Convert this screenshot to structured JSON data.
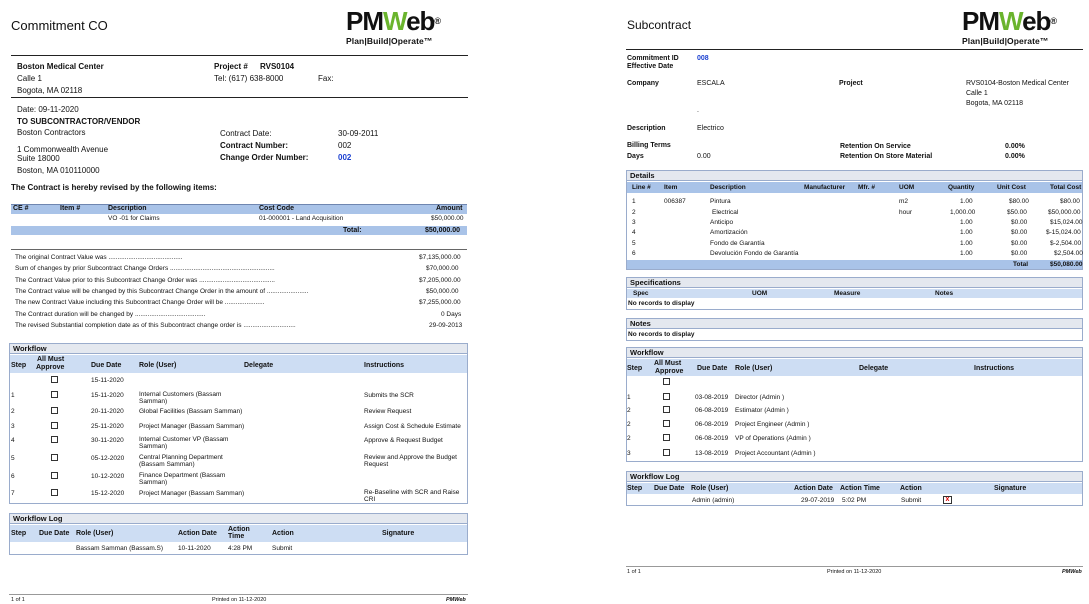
{
  "logo": {
    "brand_pm": "PM",
    "brand_w": "W",
    "brand_eb": "eb",
    "registered": "®",
    "tagline": "Plan|Build|Operate™"
  },
  "left": {
    "title": "Commitment CO",
    "client": {
      "name": "Boston Medical Center",
      "address1": "Calle 1",
      "city": "Bogota, MA 02118"
    },
    "project": {
      "label": "Project #",
      "value": "RVS0104",
      "tel": "Tel: (617) 638-8000",
      "fax": "Fax:"
    },
    "date": "Date: 09-11-2020",
    "to_label": "TO SUBCONTRACTOR/VENDOR",
    "vendor": {
      "name": "Boston Contractors",
      "address1": "1 Commonwealth Avenue",
      "address2": "Suite 18000",
      "city": "Boston, MA 010110000"
    },
    "contract": {
      "date_label": "Contract Date:",
      "date_value": "30-09-2011",
      "number_label": "Contract Number:",
      "number_value": "002",
      "co_label": "Change Order Number:",
      "co_value": "002"
    },
    "revised_text": "The Contract is hereby revised by the following items:",
    "items": {
      "headers": [
        "CE #",
        "Item #",
        "Description",
        "Cost Code",
        "Amount"
      ],
      "rows": [
        {
          "ce": "",
          "item": "",
          "description": "VO -01 for Claims",
          "cost_code": "01-000001 - Land Acquisition",
          "amount": "$50,000.00"
        }
      ],
      "total_label": "Total:",
      "total_value": "$50,000.00"
    },
    "summary": [
      {
        "label": "The original Contract Value was .........................................",
        "value": "$7,135,000.00"
      },
      {
        "label": "Sum of changes by prior Subcontract Change Orders ..........................................................",
        "value": "$70,000.00"
      },
      {
        "label": "The Contract Value prior to this Subcontract Change Order was ..........................................",
        "value": "$7,205,000.00"
      },
      {
        "label": "The Contract value will be changed by this Subcontract Change Order in the amount of .......................",
        "value": "$50,000.00"
      },
      {
        "label": "The new Contract Value including this Subcontract Change Order will be ......................",
        "value": "$7,255,000.00"
      },
      {
        "label": "The Contract duration will be changed by .......................................",
        "value": "0 Days"
      },
      {
        "label": "The revised Substantial completion date as  of this Subcontract change order is .............................",
        "value": "29-09-2013"
      }
    ],
    "workflow": {
      "title": "Workflow",
      "headers": {
        "step": "Step",
        "all_must": "All Must",
        "approve": "Approve",
        "due": "Due Date",
        "role": "Role (User)",
        "delegate": "Delegate",
        "instructions": "Instructions"
      },
      "rows": [
        {
          "step": "",
          "due": "15-11-2020",
          "role": "",
          "role2": "",
          "instr": "",
          "instr2": ""
        },
        {
          "step": "1",
          "due": "15-11-2020",
          "role": "Internal Customers (Bassam",
          "role2": "Samman)",
          "instr": "Submits the SCR",
          "instr2": ""
        },
        {
          "step": "2",
          "due": "20-11-2020",
          "role": "Global Facilities (Bassam Samman)",
          "role2": "",
          "instr": "Review Request",
          "instr2": ""
        },
        {
          "step": "3",
          "due": "25-11-2020",
          "role": "Project Manager (Bassam Samman)",
          "role2": "",
          "instr": "Assign Cost & Schedule Estimate",
          "instr2": ""
        },
        {
          "step": "4",
          "due": "30-11-2020",
          "role": "Internal Customer VP (Bassam",
          "role2": "Samman)",
          "instr": "Approve & Request Budget",
          "instr2": ""
        },
        {
          "step": "5",
          "due": "05-12-2020",
          "role": "Central Planning Department",
          "role2": "(Bassam Samman)",
          "instr": "Review and Approve the Budget",
          "instr2": "Request"
        },
        {
          "step": "6",
          "due": "10-12-2020",
          "role": "Finance Department (Bassam",
          "role2": "Samman)",
          "instr": "",
          "instr2": ""
        },
        {
          "step": "7",
          "due": "15-12-2020",
          "role": "Project Manager (Bassam Samman)",
          "role2": "",
          "instr": "Re-Baseline with SCR and Raise",
          "instr2": "CRI"
        }
      ]
    },
    "log": {
      "title": "Workflow Log",
      "headers": {
        "step": "Step",
        "due": "Due Date",
        "role": "Role (User)",
        "action_date": "Action Date",
        "action_time1": "Action",
        "action_time2": "Time",
        "action": "Action",
        "signature": "Signature"
      },
      "row": {
        "role": "Bassam Samman (Bassam.S)",
        "action_date": "10-11-2020",
        "action_time": "4:28 PM",
        "action": "Submit"
      }
    },
    "footer": {
      "page": "1 of 1",
      "printed": "Printed on 11-12-2020",
      "brand": "PMWeb"
    }
  },
  "right": {
    "title": "Subcontract",
    "commitment_id_label": "Commitment ID",
    "commitment_id_value": "008",
    "effective_date_label": "Effective Date",
    "company_label": "Company",
    "company_value": "ESCALA",
    "project_label": "Project",
    "project_value": "RVS0104-Boston Medical Center",
    "project_addr1": "Calle 1",
    "project_city": "Bogota, MA 02118",
    "dot": ".",
    "description_label": "Description",
    "description_value": "Electrico",
    "billing_terms_label": "Billing Terms",
    "days_label": "Days",
    "days_value": "0.00",
    "retention_service_label": "Retention On Service",
    "retention_service_value": "0.00%",
    "retention_store_label": "Retention On Store Material",
    "retention_store_value": "0.00%",
    "details": {
      "title": "Details",
      "headers": [
        "Line #",
        "Item",
        "Description",
        "Manufacturer",
        "Mfr. #",
        "UOM",
        "Quantity",
        "Unit Cost",
        "Total Cost"
      ],
      "rows": [
        {
          "line": "1",
          "item": "006387",
          "desc": "Pintura",
          "uom": "m2",
          "qty": "1.00",
          "unit": "$80.00",
          "total": "$80.00"
        },
        {
          "line": "2",
          "item": "",
          "desc": "Electrical",
          "uom": "hour",
          "qty": "1,000.00",
          "unit": "$50.00",
          "total": "$50,000.00"
        },
        {
          "line": "3",
          "item": "",
          "desc": "Anticipo",
          "uom": "",
          "qty": "1.00",
          "unit": "$0.00",
          "total": "$15,024.00"
        },
        {
          "line": "4",
          "item": "",
          "desc": "Amortización",
          "uom": "",
          "qty": "1.00",
          "unit": "$0.00",
          "total": "$-15,024.00"
        },
        {
          "line": "5",
          "item": "",
          "desc": "Fondo de Garantía",
          "uom": "",
          "qty": "1.00",
          "unit": "$0.00",
          "total": "$-2,504.00"
        },
        {
          "line": "6",
          "item": "",
          "desc": "Devolución Fondo de Garantía",
          "uom": "",
          "qty": "1.00",
          "unit": "$0.00",
          "total": "$2,504.00"
        }
      ],
      "total_label": "Total",
      "total_value": "$50,080.00"
    },
    "specs": {
      "title": "Specifications",
      "headers": [
        "Spec",
        "UOM",
        "Measure",
        "Notes"
      ],
      "empty": "No records to display"
    },
    "notes": {
      "title": "Notes",
      "empty": "No records to display"
    },
    "workflow": {
      "title": "Workflow",
      "headers": {
        "step": "Step",
        "all_must": "All Must",
        "approve": "Approve",
        "due": "Due Date",
        "role": "Role (User)",
        "delegate": "Delegate",
        "instructions": "Instructions"
      },
      "rows": [
        {
          "step": "",
          "due": "",
          "role": ""
        },
        {
          "step": "1",
          "due": "03-08-2019",
          "role": "Director (Admin )"
        },
        {
          "step": "2",
          "due": "06-08-2019",
          "role": "Estimator (Admin )"
        },
        {
          "step": "2",
          "due": "06-08-2019",
          "role": "Project Engineer (Admin )"
        },
        {
          "step": "2",
          "due": "06-08-2019",
          "role": "VP of Operations (Admin )"
        },
        {
          "step": "3",
          "due": "13-08-2019",
          "role": "Project Accountant (Admin )"
        }
      ]
    },
    "log": {
      "title": "Workflow Log",
      "headers": {
        "step": "Step",
        "due": "Due Date",
        "role": "Role (User)",
        "action_date": "Action Date",
        "action_time": "Action Time",
        "action": "Action",
        "signature": "Signature"
      },
      "row": {
        "role": "Admin  (admin)",
        "action_date": "29-07-2019",
        "action_time": "5:02 PM",
        "action": "Submit",
        "sig": "x"
      }
    },
    "footer": {
      "page": "1 of 1",
      "printed": "Printed on 11-12-2020",
      "brand": "PMWeb"
    }
  }
}
